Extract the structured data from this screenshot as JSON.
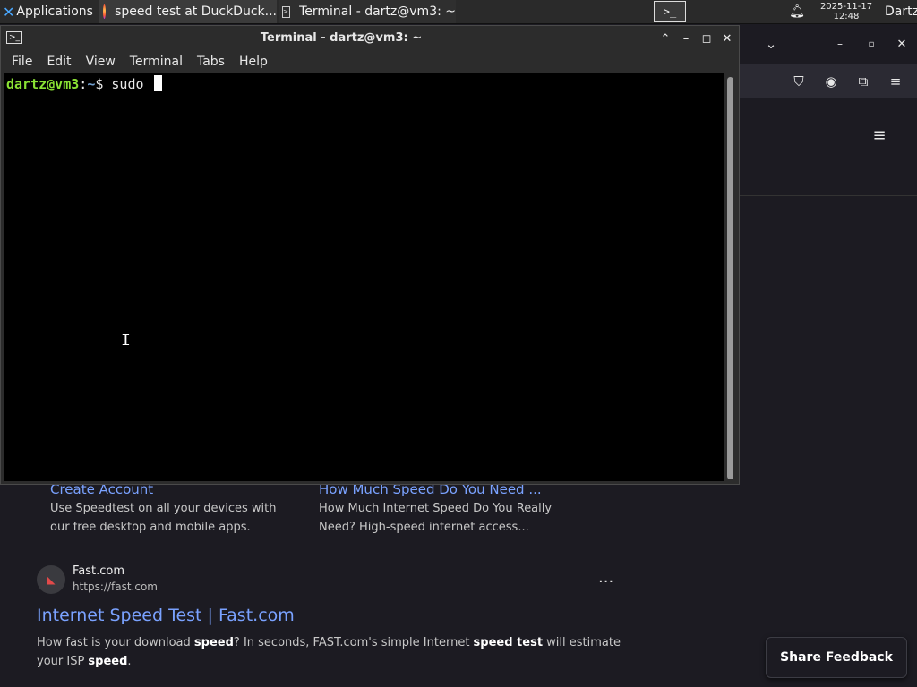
{
  "taskbar": {
    "applications_label": "Applications",
    "tasks": [
      {
        "label": "speed test at DuckDuck..."
      },
      {
        "label": "Terminal - dartz@vm3: ~"
      }
    ],
    "clock_date": "2025-11-17",
    "clock_time": "12:48",
    "user": "Dartz"
  },
  "terminal": {
    "title": "Terminal - dartz@vm3: ~",
    "menu": [
      "File",
      "Edit",
      "View",
      "Terminal",
      "Tabs",
      "Help"
    ],
    "prompt_user": "dartz@vm3",
    "prompt_sep": ":",
    "prompt_path": "~",
    "prompt_symbol": "$",
    "command": "sudo "
  },
  "browser": {
    "results_top": [
      {
        "title": "Create Account",
        "desc": "Use Speedtest on all your devices with our free desktop and mobile apps."
      },
      {
        "title": "How Much Speed Do You Need ...",
        "desc": "How Much Internet Speed Do You Really Need? High-speed internet access..."
      }
    ],
    "fast": {
      "site": "Fast.com",
      "url": "https://fast.com",
      "title": "Internet Speed Test | Fast.com",
      "desc_parts": [
        "How fast is your download ",
        "speed",
        "? In seconds, FAST.com's simple Internet ",
        "speed test",
        " will estimate your ISP ",
        "speed",
        "."
      ]
    },
    "share_feedback": "Share Feedback"
  },
  "icons": {
    "apps": "xfce-logo-icon",
    "firefox": "firefox-icon",
    "terminal": "terminal-icon",
    "bell": "bell-icon",
    "pocket": "pocket-icon",
    "account": "account-icon",
    "extensions": "extensions-icon",
    "menu": "hamburger-menu-icon"
  }
}
